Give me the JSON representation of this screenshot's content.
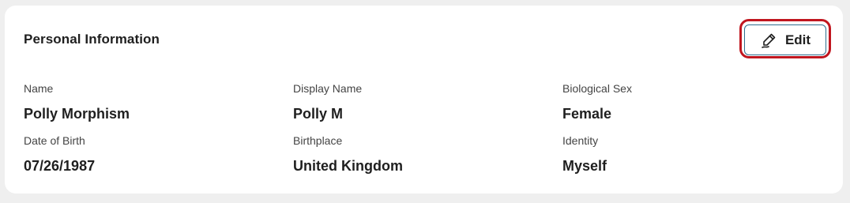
{
  "card": {
    "title": "Personal Information",
    "edit_label": "Edit",
    "edit_icon": "pencil-icon"
  },
  "fields": [
    {
      "label": "Name",
      "value": "Polly Morphism"
    },
    {
      "label": "Display Name",
      "value": "Polly M"
    },
    {
      "label": "Biological Sex",
      "value": "Female"
    },
    {
      "label": "Date of Birth",
      "value": "07/26/1987"
    },
    {
      "label": "Birthplace",
      "value": "United Kingdom"
    },
    {
      "label": "Identity",
      "value": "Myself"
    }
  ],
  "colors": {
    "highlight": "#c0161f",
    "button_border": "#2f6f8f"
  }
}
